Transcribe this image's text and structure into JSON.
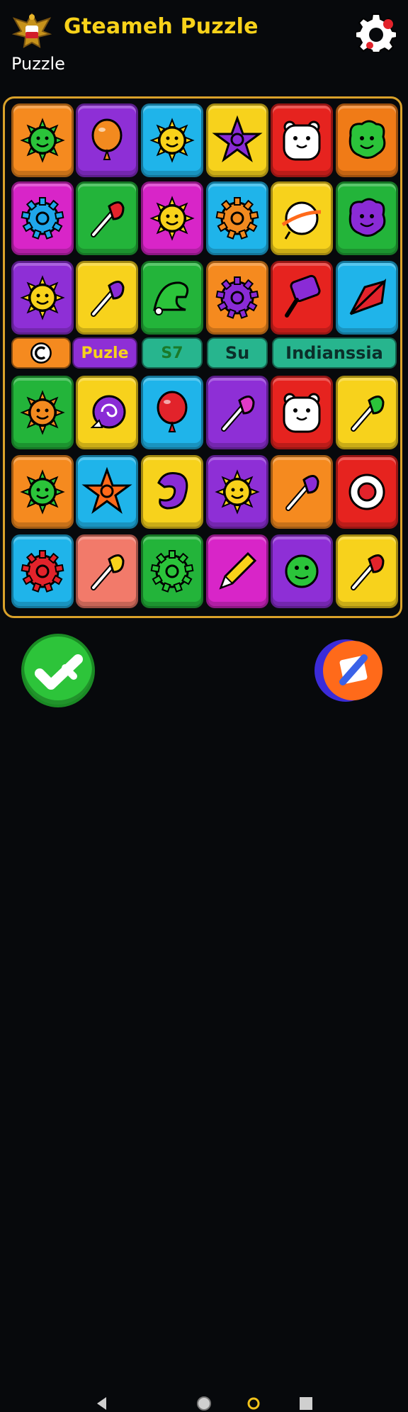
{
  "app": {
    "title": "Gteameh Puzzle",
    "subtitle": "Puzzle"
  },
  "colors": {
    "accent": "#f8d21a",
    "board_border": "#d9a12a",
    "background": "#07090c"
  },
  "board": {
    "rows": [
      [
        {
          "bg": "#f58a1f",
          "icon": "green-sun-icon"
        },
        {
          "bg": "#8e2fd6",
          "icon": "orange-balloon-icon"
        },
        {
          "bg": "#1fb4ea",
          "icon": "yellow-sun-icon"
        },
        {
          "bg": "#f7d21c",
          "icon": "purple-star-icon"
        },
        {
          "bg": "#e6231f",
          "icon": "white-bear-icon"
        },
        {
          "bg": "#f07b17",
          "icon": "green-blob-icon"
        }
      ],
      [
        {
          "bg": "#d825c8",
          "icon": "blue-gear-icon"
        },
        {
          "bg": "#23b43a",
          "icon": "red-brush-icon"
        },
        {
          "bg": "#d825c8",
          "icon": "yellow-sun-icon"
        },
        {
          "bg": "#1fb4ea",
          "icon": "orange-gear-icon"
        },
        {
          "bg": "#f7d21c",
          "icon": "planet-icon"
        },
        {
          "bg": "#23b43a",
          "icon": "purple-blob-icon"
        }
      ],
      [
        {
          "bg": "#8e2fd6",
          "icon": "yellow-sun-icon"
        },
        {
          "bg": "#f7d21c",
          "icon": "purple-brush-icon"
        },
        {
          "bg": "#23b43a",
          "icon": "green-hat-icon"
        },
        {
          "bg": "#f58a1f",
          "icon": "purple-gear-icon"
        },
        {
          "bg": "#e6231f",
          "icon": "purple-paddle-icon"
        },
        {
          "bg": "#1fb4ea",
          "icon": "red-fan-icon"
        }
      ],
      [
        {
          "bg": "#23b43a",
          "icon": "orange-sun-icon"
        },
        {
          "bg": "#f7d21c",
          "icon": "purple-swirl-icon"
        },
        {
          "bg": "#1fb4ea",
          "icon": "red-balloon-icon"
        },
        {
          "bg": "#8e2fd6",
          "icon": "pink-brush-icon"
        },
        {
          "bg": "#e6231f",
          "icon": "white-bear-icon"
        },
        {
          "bg": "#f7d21c",
          "icon": "green-brush-icon"
        }
      ],
      [
        {
          "bg": "#f58a1f",
          "icon": "green-sun-icon"
        },
        {
          "bg": "#1fb4ea",
          "icon": "rainbow-star-icon"
        },
        {
          "bg": "#f7d21c",
          "icon": "purple-hook-icon"
        },
        {
          "bg": "#8e2fd6",
          "icon": "yellow-sun-icon"
        },
        {
          "bg": "#f58a1f",
          "icon": "purple-brush-icon"
        },
        {
          "bg": "#e6231f",
          "icon": "red-eye-icon"
        }
      ],
      [
        {
          "bg": "#1fb4ea",
          "icon": "red-gear-icon"
        },
        {
          "bg": "#f27a6a",
          "icon": "yellow-brush-icon"
        },
        {
          "bg": "#23b43a",
          "icon": "green-gear-icon"
        },
        {
          "bg": "#d825c8",
          "icon": "yellow-pencil-icon"
        },
        {
          "bg": "#8e2fd6",
          "icon": "green-face-icon"
        },
        {
          "bg": "#f7d21c",
          "icon": "red-brush-icon"
        }
      ]
    ]
  },
  "strip": [
    {
      "label": "",
      "icon": "c-coin-icon",
      "bg": "#f58a1f",
      "fg": "#ffffff"
    },
    {
      "label": "Puzle",
      "bg": "#8e2fd6",
      "fg": "#f7d21c"
    },
    {
      "label": "S7",
      "bg": "#27b58e",
      "fg": "#1a7a2a"
    },
    {
      "label": "Su",
      "bg": "#27b58e",
      "fg": "#0b2f2a"
    },
    {
      "label": "Indianssia",
      "bg": "#27b58e",
      "fg": "#0b2f2a"
    }
  ],
  "controls": {
    "left_icon": "check-icon",
    "right_icon": "shuffle-icon"
  },
  "navbar": {
    "icons": [
      "back-icon",
      "home-icon",
      "recent-icon",
      "square-icon"
    ]
  }
}
